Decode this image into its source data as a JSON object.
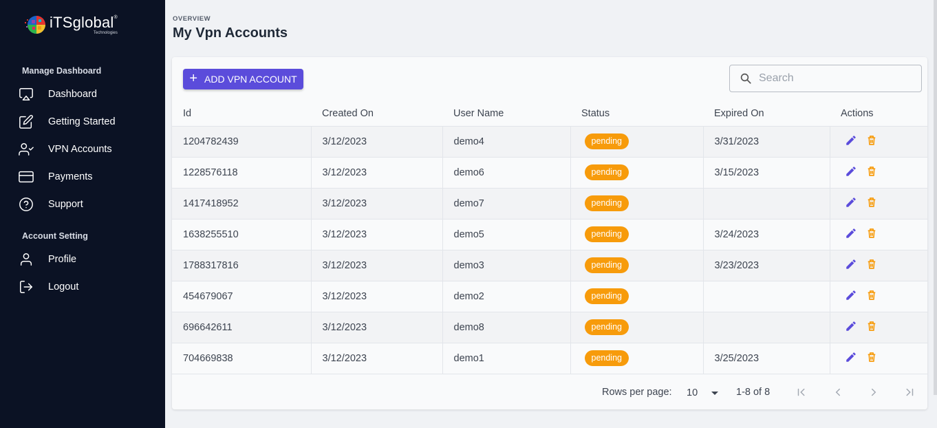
{
  "brand": {
    "name": "iTSglobal",
    "reg": "®",
    "sub": "Technologies"
  },
  "sidebar": {
    "section_manage": "Manage Dashboard",
    "section_account": "Account Setting",
    "items": [
      {
        "label": "Dashboard",
        "icon": "airplay-icon"
      },
      {
        "label": "Getting Started",
        "icon": "edit-icon"
      },
      {
        "label": "VPN Accounts",
        "icon": "user-check-icon"
      },
      {
        "label": "Payments",
        "icon": "credit-card-icon"
      },
      {
        "label": "Support",
        "icon": "help-circle-icon"
      },
      {
        "label": "Profile",
        "icon": "user-icon"
      },
      {
        "label": "Logout",
        "icon": "logout-icon"
      }
    ]
  },
  "header": {
    "overview": "OVERVIEW",
    "title": "My Vpn Accounts"
  },
  "toolbar": {
    "add_label": "ADD VPN ACCOUNT",
    "search_placeholder": "Search"
  },
  "table": {
    "columns": [
      "Id",
      "Created On",
      "User Name",
      "Status",
      "Expired On",
      "Actions"
    ],
    "rows": [
      {
        "id": "1204782439",
        "created": "3/12/2023",
        "user": "demo4",
        "status": "pending",
        "expired": "3/31/2023"
      },
      {
        "id": "1228576118",
        "created": "3/12/2023",
        "user": "demo6",
        "status": "pending",
        "expired": "3/15/2023"
      },
      {
        "id": "1417418952",
        "created": "3/12/2023",
        "user": "demo7",
        "status": "pending",
        "expired": ""
      },
      {
        "id": "1638255510",
        "created": "3/12/2023",
        "user": "demo5",
        "status": "pending",
        "expired": "3/24/2023"
      },
      {
        "id": "1788317816",
        "created": "3/12/2023",
        "user": "demo3",
        "status": "pending",
        "expired": "3/23/2023"
      },
      {
        "id": "454679067",
        "created": "3/12/2023",
        "user": "demo2",
        "status": "pending",
        "expired": ""
      },
      {
        "id": "696642611",
        "created": "3/12/2023",
        "user": "demo8",
        "status": "pending",
        "expired": ""
      },
      {
        "id": "704669838",
        "created": "3/12/2023",
        "user": "demo1",
        "status": "pending",
        "expired": "3/25/2023"
      }
    ]
  },
  "pagination": {
    "rows_label": "Rows per page:",
    "rows_value": "10",
    "range": "1-8 of 8"
  },
  "colors": {
    "sidebar": "#0b1224",
    "accent": "#5b4cdb",
    "badge": "#f79b0b",
    "edit": "#5b4cdb",
    "delete": "#f79b0b"
  }
}
